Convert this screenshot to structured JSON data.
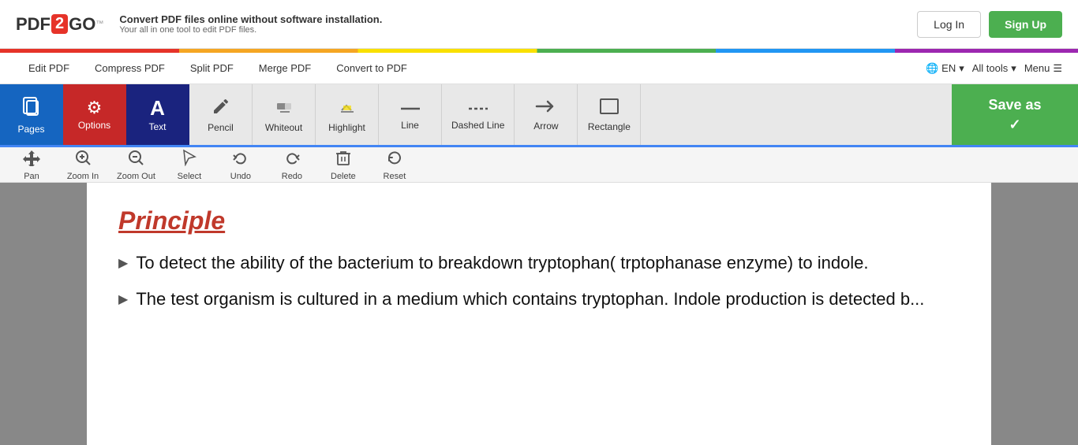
{
  "brand": {
    "pdf": "PDF",
    "two": "2",
    "go": "GO",
    "tm": "™"
  },
  "tagline": {
    "main": "Convert PDF files online without software installation.",
    "sub": "Your all in one tool to edit PDF files."
  },
  "header_buttons": {
    "login": "Log In",
    "signup": "Sign Up"
  },
  "nav": {
    "items": [
      "Edit PDF",
      "Compress PDF",
      "Split PDF",
      "Merge PDF",
      "Convert to PDF"
    ],
    "right": [
      "EN",
      "All tools",
      "Menu"
    ]
  },
  "toolbar": {
    "pages_label": "Pages",
    "options_label": "Options",
    "text_label": "Text",
    "pencil_label": "Pencil",
    "whiteout_label": "Whiteout",
    "highlight_label": "Highlight",
    "line_label": "Line",
    "dashed_line_label": "Dashed Line",
    "arrow_label": "Arrow",
    "rectangle_label": "Rectangle",
    "save_as_label": "Save as"
  },
  "toolbar2": {
    "pan_label": "Pan",
    "zoom_in_label": "Zoom In",
    "zoom_out_label": "Zoom Out",
    "select_label": "Select",
    "undo_label": "Undo",
    "redo_label": "Redo",
    "delete_label": "Delete",
    "reset_label": "Reset"
  },
  "content": {
    "heading": "Principle",
    "items": [
      "To detect the ability of the bacterium to breakdown tryptophan( trptophanase enzyme) to indole.",
      "The test organism is cultured in a medium which contains tryptophan. Indole production is detected b..."
    ]
  }
}
